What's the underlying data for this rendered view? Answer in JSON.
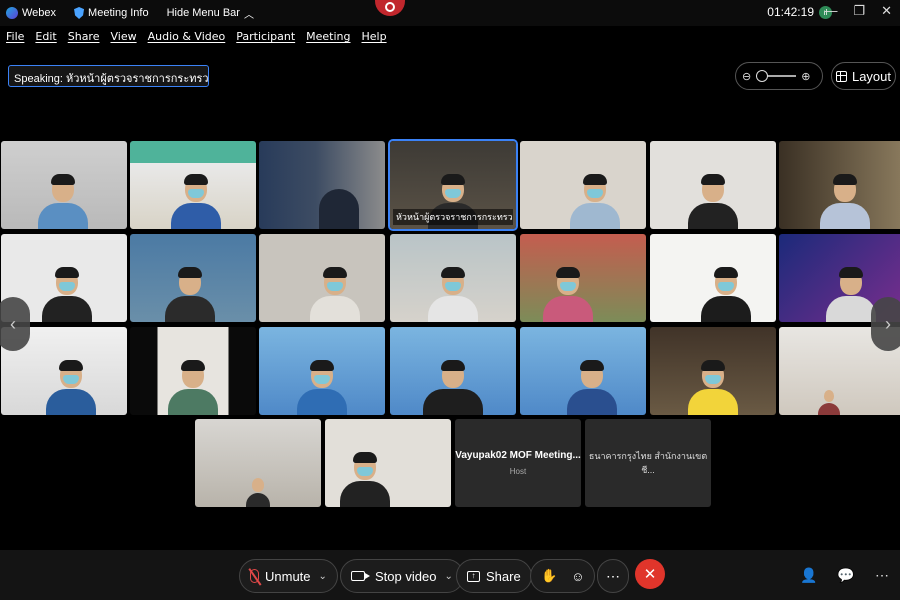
{
  "titlebar": {
    "app_name": "Webex",
    "meeting_info": "Meeting Info",
    "hide_menu": "Hide Menu Bar",
    "clock": "01:42:19"
  },
  "menu": [
    "File",
    "Edit",
    "Share",
    "View",
    "Audio & Video",
    "Participant",
    "Meeting",
    "Help"
  ],
  "speaking": "Speaking: หัวหน้าผู้ตรวจราชการกระทรวงการคลัง",
  "layout_label": "Layout",
  "tiles": {
    "active_name": "หัวหน้าผู้ตรวจราชการกระทรวงการ...",
    "blank1_name": "Vayupak02 MOF Meeting...",
    "blank1_sub": "Host",
    "blank2_name": "ธนาคารกรุงไทย สำนักงานเขตชี..."
  },
  "controls": {
    "unmute": "Unmute",
    "stop_video": "Stop video",
    "share": "Share"
  },
  "colors": {
    "accent": "#3b82f6",
    "end_call": "#e0352b",
    "muted": "#e04848"
  }
}
